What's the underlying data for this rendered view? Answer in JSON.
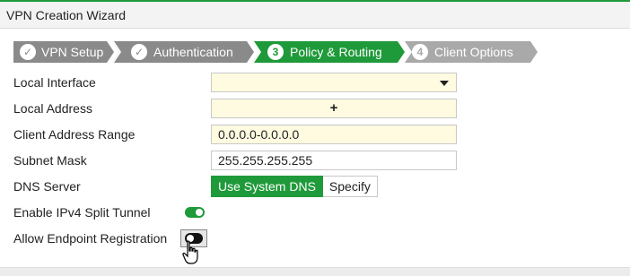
{
  "window": {
    "title": "VPN Creation Wizard"
  },
  "steps": [
    {
      "number": "✓",
      "label": "VPN Setup",
      "state": "completed",
      "color": "#8a8a8a"
    },
    {
      "number": "✓",
      "label": "Authentication",
      "state": "completed",
      "color": "#8a8a8a"
    },
    {
      "number": "3",
      "label": "Policy & Routing",
      "state": "active",
      "color": "#1f9a3a"
    },
    {
      "number": "4",
      "label": "Client Options",
      "state": "pending",
      "color": "#a9a9a9"
    }
  ],
  "form": {
    "local_interface": {
      "label": "Local Interface",
      "value": "",
      "icon": "chevron-down-icon"
    },
    "local_address": {
      "label": "Local Address",
      "value": "+",
      "icon": "plus-icon"
    },
    "client_address_range": {
      "label": "Client Address Range",
      "value": "0.0.0.0-0.0.0.0"
    },
    "subnet_mask": {
      "label": "Subnet Mask",
      "value": "255.255.255.255"
    },
    "dns_server": {
      "label": "DNS Server",
      "options": [
        "Use System DNS",
        "Specify"
      ],
      "selected": "Use System DNS"
    },
    "split_tunnel": {
      "label": "Enable IPv4 Split Tunnel",
      "enabled": true
    },
    "endpoint_registration": {
      "label": "Allow Endpoint Registration",
      "enabled": false
    }
  },
  "colors": {
    "accent": "#1f9a3a",
    "field_yellow": "#fefbe0",
    "step_completed": "#8a8a8a",
    "step_pending": "#a9a9a9"
  }
}
